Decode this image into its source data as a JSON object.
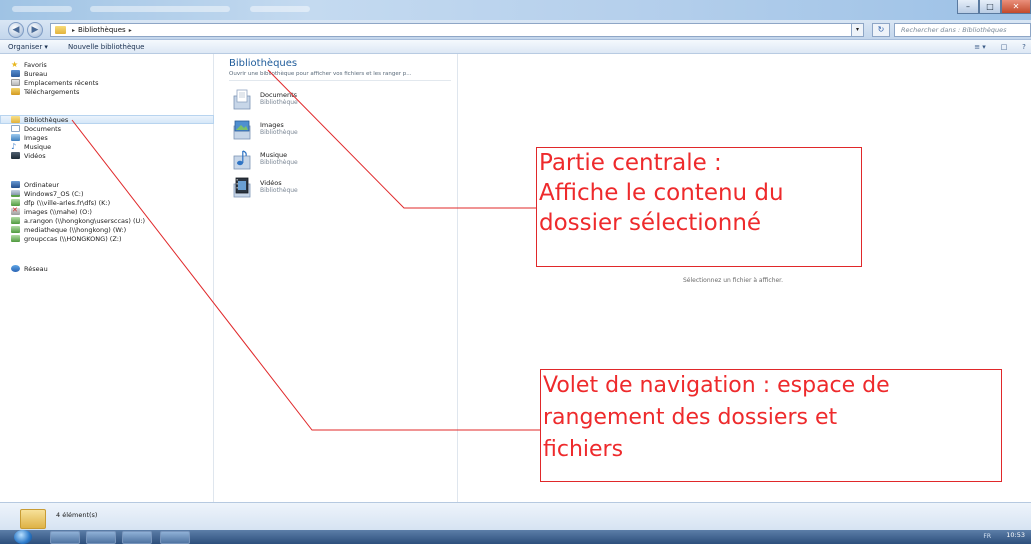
{
  "window": {
    "title_blurred": "",
    "buttons": {
      "minimize": "–",
      "maximize": "□",
      "close": "✕"
    }
  },
  "address": {
    "back_icon": "back-arrow-icon",
    "forward_icon": "forward-arrow-icon",
    "separator": "▸",
    "path": "Bibliothèques",
    "trailing": "▸",
    "dropdown": "▾",
    "refresh": "↻",
    "search_placeholder": "Rechercher dans : Bibliothèques"
  },
  "toolbar": {
    "organize_label": "Organiser ▾",
    "new_library_label": "Nouvelle bibliothèque",
    "view_icon": "≡ ▾",
    "preview_icon": "□",
    "help_icon": "?"
  },
  "nav": {
    "favorites": {
      "label": "Favoris",
      "items": [
        "Bureau",
        "Emplacements récents",
        "Téléchargements"
      ]
    },
    "libraries": {
      "label": "Bibliothèques",
      "items": [
        "Documents",
        "Images",
        "Musique",
        "Vidéos"
      ]
    },
    "computer": {
      "label": "Ordinateur",
      "items": [
        "Windows7_OS (C:)",
        "dfp (\\\\ville-arles.fr\\dfs) (K:)",
        "images (\\\\mahe) (O:)",
        "a.rangon (\\\\hongkong\\usersccas) (U:)",
        "mediatheque (\\\\hongkong) (W:)",
        "groupccas (\\\\HONGKONG) (Z:)"
      ]
    },
    "network": {
      "label": "Réseau"
    }
  },
  "center": {
    "title": "Bibliothèques",
    "subtitle": "Ouvrir une bibliothèque pour afficher vos fichiers et les ranger p...",
    "libraries": [
      {
        "name": "Documents",
        "type": "Bibliothèque",
        "icon": "documents-library-icon"
      },
      {
        "name": "Images",
        "type": "Bibliothèque",
        "icon": "images-library-icon"
      },
      {
        "name": "Musique",
        "type": "Bibliothèque",
        "icon": "music-library-icon"
      },
      {
        "name": "Vidéos",
        "type": "Bibliothèque",
        "icon": "videos-library-icon"
      }
    ]
  },
  "preview": {
    "message": "Sélectionnez un fichier à afficher."
  },
  "status": {
    "count": "4 élément(s)"
  },
  "taskbar": {
    "tray": "FR",
    "clock": "10:53"
  },
  "annotations": {
    "center": [
      "Partie centrale :",
      "Affiche le contenu du",
      "dossier sélectionné"
    ],
    "nav": [
      "Volet de navigation : espace de",
      "rangement des dossiers et",
      "fichiers"
    ],
    "line_color": "#e0282a"
  },
  "colors": {
    "library_title": "#1e5b9a",
    "annotation": "#ee2a2c"
  }
}
